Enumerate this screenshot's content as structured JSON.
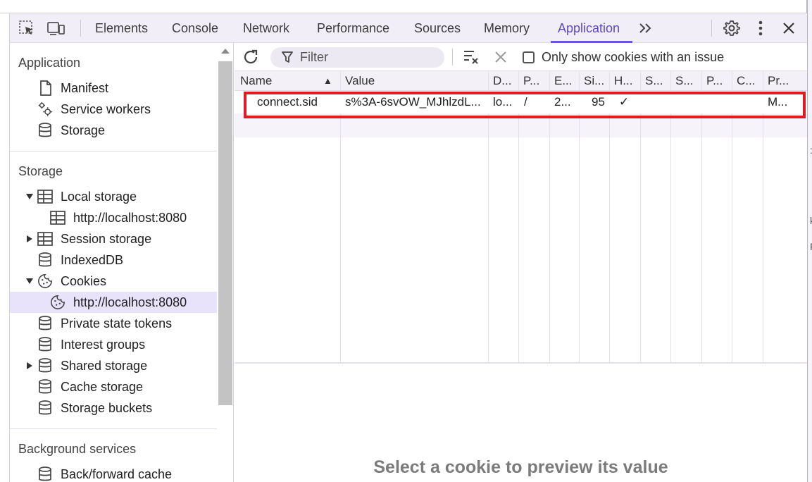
{
  "toolbar": {
    "tabs": [
      {
        "label": "Elements"
      },
      {
        "label": "Console"
      },
      {
        "label": "Network"
      },
      {
        "label": "Performance"
      },
      {
        "label": "Sources"
      },
      {
        "label": "Memory"
      },
      {
        "label": "Application"
      }
    ],
    "active_tab": "Application",
    "accent_color": "#6a55d8"
  },
  "sidebar": {
    "sections": {
      "application": "Application",
      "storage": "Storage",
      "background": "Background services"
    },
    "items": [
      {
        "label": "Manifest",
        "icon": "file-icon"
      },
      {
        "label": "Service workers",
        "icon": "gears-icon"
      },
      {
        "label": "Storage",
        "icon": "database-icon"
      },
      {
        "label": "Local storage",
        "icon": "table-icon",
        "expanded": true
      },
      {
        "label": "http://localhost:8080",
        "icon": "table-icon"
      },
      {
        "label": "Session storage",
        "icon": "table-icon",
        "expanded": false
      },
      {
        "label": "IndexedDB",
        "icon": "database-icon"
      },
      {
        "label": "Cookies",
        "icon": "cookie-icon",
        "expanded": true
      },
      {
        "label": "http://localhost:8080",
        "icon": "cookie-icon",
        "selected": true
      },
      {
        "label": "Private state tokens",
        "icon": "database-icon"
      },
      {
        "label": "Interest groups",
        "icon": "database-icon"
      },
      {
        "label": "Shared storage",
        "icon": "database-icon",
        "expanded": false
      },
      {
        "label": "Cache storage",
        "icon": "database-icon"
      },
      {
        "label": "Storage buckets",
        "icon": "database-icon"
      },
      {
        "label": "Back/forward cache",
        "icon": "database-icon"
      }
    ]
  },
  "cookies": {
    "filter_placeholder": "Filter",
    "only_issue_label": "Only show cookies with an issue",
    "columns": [
      "Name",
      "Value",
      "D...",
      "P...",
      "E...",
      "Si...",
      "H...",
      "S...",
      "S...",
      "P...",
      "C...",
      "Pr..."
    ],
    "sort_indicator": "▲",
    "rows": [
      {
        "name": "connect.sid",
        "value": "s%3A-6svOW_MJhlzdL...",
        "domain": "lo...",
        "path": "/",
        "expires": "2...",
        "size": "95",
        "httponly": "✓",
        "priority": "M..."
      }
    ],
    "highlight_color": "#e01b24",
    "preview_message": "Select a cookie to preview its value"
  }
}
